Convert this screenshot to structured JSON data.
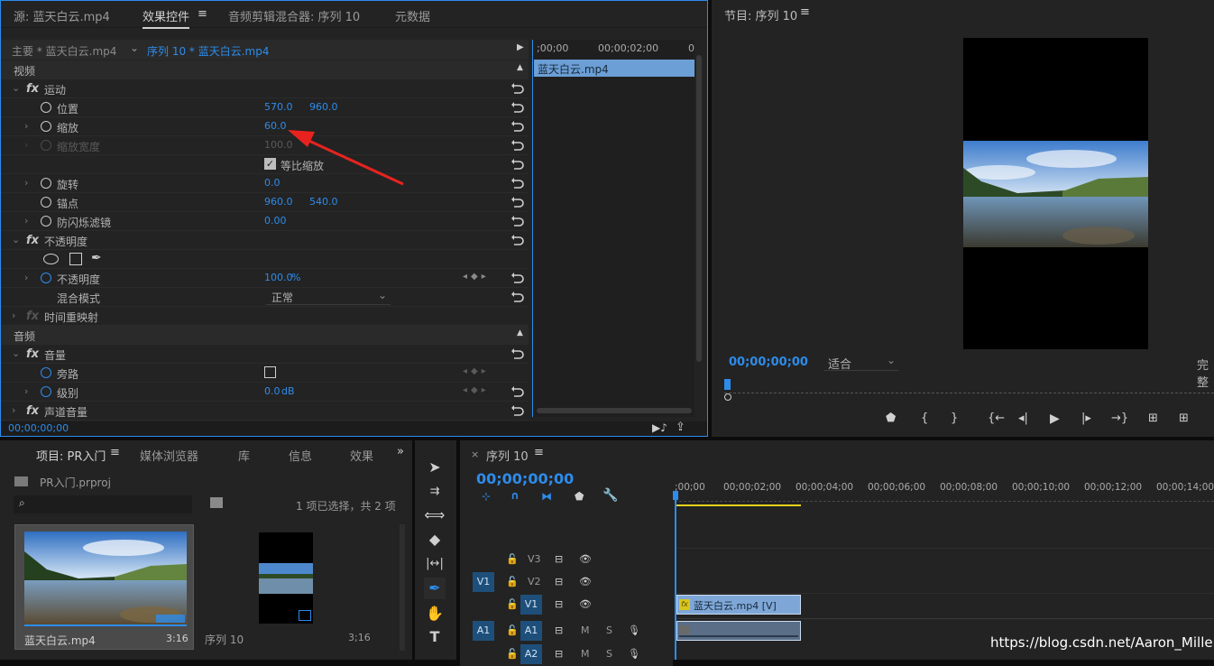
{
  "source_panel": {
    "tabs": [
      "源: 蓝天白云.mp4",
      "效果控件",
      "音频剪辑混合器: 序列 10",
      "元数据"
    ],
    "menu_icon": "hamburger-icon",
    "master_clip": "主要 * 蓝天白云.mp4",
    "sequence_clip": "序列 10 * 蓝天白云.mp4",
    "mini_timeline": {
      "t0": ";00;00",
      "t1": "00;00;02;00",
      "t2": "0",
      "clip": "蓝天白云.mp4"
    },
    "sections": {
      "video": "视频",
      "audio": "音频"
    },
    "motion": {
      "name": "运动",
      "position": {
        "label": "位置",
        "x": "570.0",
        "y": "960.0"
      },
      "scale": {
        "label": "缩放",
        "value": "60.0"
      },
      "scale_width": {
        "label": "缩放宽度",
        "value": "100.0"
      },
      "uniform": {
        "label": "等比缩放",
        "checked": true
      },
      "rotation": {
        "label": "旋转",
        "value": "0.0"
      },
      "anchor": {
        "label": "锚点",
        "x": "960.0",
        "y": "540.0"
      },
      "flicker": {
        "label": "防闪烁滤镜",
        "value": "0.00"
      }
    },
    "opacity": {
      "name": "不透明度",
      "value_label": "不透明度",
      "value": "100.0",
      "unit": "%",
      "blend_label": "混合模式",
      "blend_value": "正常"
    },
    "time_remap": "时间重映射",
    "volume": {
      "name": "音量",
      "bypass": "旁路",
      "level": "级别",
      "level_value": "0.0",
      "level_unit": "dB"
    },
    "channel_volume": "声道音量",
    "timecode": "00;00;00;00"
  },
  "program_panel": {
    "title": "节目: 序列 10",
    "timecode": "00;00;00;00",
    "fit": "适合",
    "quality": "完整"
  },
  "project_panel": {
    "tabs": [
      "项目: PR入门",
      "媒体浏览器",
      "库",
      "信息",
      "效果"
    ],
    "project_file": "PR入门.prproj",
    "selection": "1 项已选择，共 2 项",
    "items": [
      {
        "name": "蓝天白云.mp4",
        "duration": "3:16"
      },
      {
        "name": "序列 10",
        "duration": "3;16"
      }
    ]
  },
  "timeline_panel": {
    "title": "序列 10",
    "timecode": "00;00;00;00",
    "ruler": [
      ";00;00",
      "00;00;02;00",
      "00;00;04;00",
      "00;00;06;00",
      "00;00;08;00",
      "00;00;10;00",
      "00;00;12;00",
      "00;00;14;00"
    ],
    "tracks": {
      "v3": "V3",
      "v2": "V2",
      "v1_src": "V1",
      "v1": "V1",
      "a1_src": "A1",
      "a1": "A1",
      "a2": "A2",
      "m": "M",
      "s": "S"
    },
    "clip_label": "蓝天白云.mp4 [V]"
  },
  "watermark": "https://blog.csdn.net/Aaron_Miller",
  "colors": {
    "accent": "#2d8ceb",
    "annotation_arrow": "#e8231f"
  }
}
